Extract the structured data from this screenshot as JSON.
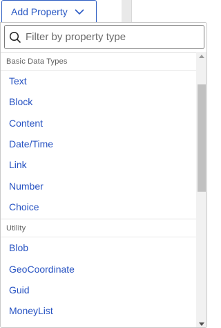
{
  "add_button": {
    "label": "Add Property",
    "icon": "chevron-down-icon"
  },
  "search": {
    "placeholder": "Filter by property type",
    "value": "",
    "icon": "search-icon"
  },
  "groups": [
    {
      "label": "Basic Data Types",
      "items": [
        "Text",
        "Block",
        "Content",
        "Date/Time",
        "Link",
        "Number",
        "Choice"
      ]
    },
    {
      "label": "Utility",
      "items": [
        "Blob",
        "GeoCoordinate",
        "Guid",
        "MoneyList"
      ]
    }
  ],
  "colors": {
    "accent": "#2a59c4",
    "link": "#2652c2",
    "border": "#c9c9c9"
  }
}
